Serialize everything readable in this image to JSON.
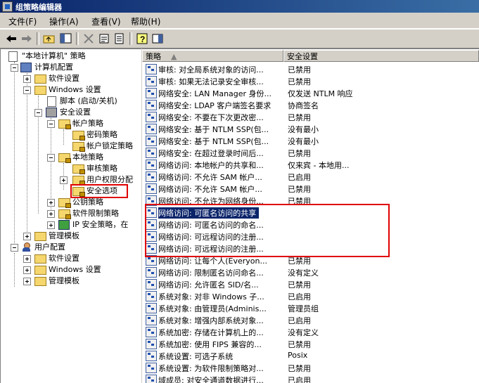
{
  "window": {
    "title": "组策略编辑器"
  },
  "menu": [
    "文件(F)",
    "操作(A)",
    "查看(V)",
    "帮助(H)"
  ],
  "tree": [
    {
      "label": "\"本地计算机\" 策略",
      "icon": "policy-icon"
    },
    {
      "label": "计算机配置",
      "icon": "computer-icon"
    },
    {
      "label": "软件设置",
      "icon": "folder-icon"
    },
    {
      "label": "Windows 设置",
      "icon": "folder-icon"
    },
    {
      "label": "脚本 (启动/关机)",
      "icon": "script-icon"
    },
    {
      "label": "安全设置",
      "icon": "security-icon"
    },
    {
      "label": "帐户策略",
      "icon": "folder-lock-icon"
    },
    {
      "label": "密码策略",
      "icon": "folder-lock-icon"
    },
    {
      "label": "帐户锁定策略",
      "icon": "folder-lock-icon"
    },
    {
      "label": "本地策略",
      "icon": "folder-lock-icon"
    },
    {
      "label": "审核策略",
      "icon": "folder-lock-icon"
    },
    {
      "label": "用户权限分配",
      "icon": "folder-lock-icon"
    },
    {
      "label": "安全选项",
      "icon": "folder-lock-icon"
    },
    {
      "label": "公钥策略",
      "icon": "folder-lock-icon"
    },
    {
      "label": "软件限制策略",
      "icon": "folder-lock-icon"
    },
    {
      "label": "IP 安全策略，在",
      "icon": "ip-security-icon"
    },
    {
      "label": "管理模板",
      "icon": "folder-icon"
    },
    {
      "label": "用户配置",
      "icon": "user-icon"
    },
    {
      "label": "软件设置",
      "icon": "folder-icon"
    },
    {
      "label": "Windows 设置",
      "icon": "folder-icon"
    },
    {
      "label": "管理模板",
      "icon": "folder-icon"
    }
  ],
  "list": {
    "columns": [
      "策略",
      "安全设置"
    ],
    "rows": [
      {
        "policy": "审核: 对全局系统对象的访问...",
        "setting": "已禁用"
      },
      {
        "policy": "审核: 如果无法记录安全审核...",
        "setting": "已禁用"
      },
      {
        "policy": "网络安全: LAN Manager 身份...",
        "setting": "仅发送 NTLM 响应"
      },
      {
        "policy": "网络安全: LDAP 客户端签名要求",
        "setting": "协商签名"
      },
      {
        "policy": "网络安全: 不要在下次更改密...",
        "setting": "已禁用"
      },
      {
        "policy": "网络安全: 基于 NTLM SSP(包...",
        "setting": "没有最小"
      },
      {
        "policy": "网络安全: 基于 NTLM SSP(包...",
        "setting": "没有最小"
      },
      {
        "policy": "网络安全: 在超过登录时间后...",
        "setting": "已禁用"
      },
      {
        "policy": "网络访问: 本地帐户的共享和...",
        "setting": "仅来宾 - 本地用..."
      },
      {
        "policy": "网络访问: 不允许 SAM 帐户...",
        "setting": "已启用"
      },
      {
        "policy": "网络访问: 不允许 SAM 帐户...",
        "setting": "已禁用"
      },
      {
        "policy": "网络访问: 不允许为网络身份...",
        "setting": "已禁用"
      },
      {
        "policy": "网络访问: 可匿名访问的共享",
        "setting": ""
      },
      {
        "policy": "网络访问: 可匿名访问的命名...",
        "setting": ""
      },
      {
        "policy": "网络访问: 可远程访问的注册...",
        "setting": ""
      },
      {
        "policy": "网络访问: 可远程访问的注册...",
        "setting": ""
      },
      {
        "policy": "网络访问: 让每个人(Everyon...",
        "setting": "已禁用"
      },
      {
        "policy": "网络访问: 限制匿名访问命名...",
        "setting": "没有定义"
      },
      {
        "policy": "网络访问: 允许匿名 SID/名...",
        "setting": "已禁用"
      },
      {
        "policy": "系统对象: 对非 Windows 子...",
        "setting": "已启用"
      },
      {
        "policy": "系统对象: 由管理员(Adminis...",
        "setting": "管理员组"
      },
      {
        "policy": "系统对象: 增强内部系统对象...",
        "setting": "已启用"
      },
      {
        "policy": "系统加密: 存储在计算机上的...",
        "setting": "没有定义"
      },
      {
        "policy": "系统加密: 使用 FIPS 兼容的...",
        "setting": "已禁用"
      },
      {
        "policy": "系统设置: 可选子系统",
        "setting": "Posix"
      },
      {
        "policy": "系统设置: 为软件限制策略对...",
        "setting": "已禁用"
      },
      {
        "policy": "域成员: 对安全通道数据进行...",
        "setting": "已启用"
      }
    ]
  }
}
